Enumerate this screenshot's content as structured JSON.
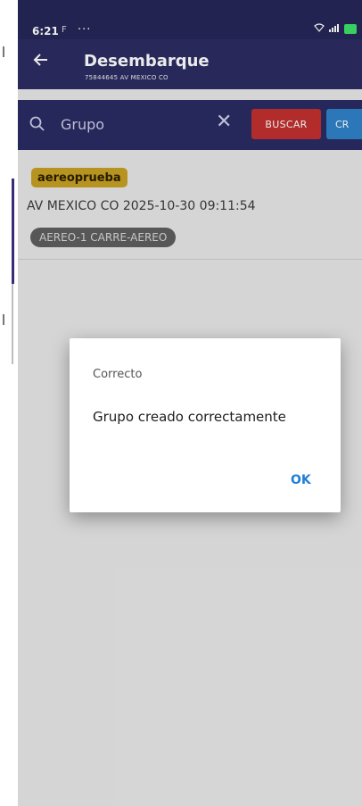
{
  "status_bar": {
    "time": "6:21",
    "notification": "F",
    "more": "···"
  },
  "app_bar": {
    "title": "Desembarque",
    "subtitle": "75844645 AV MEXICO CO",
    "back_icon": "arrow-left-icon"
  },
  "search": {
    "placeholder": "Grupo",
    "value": "",
    "search_button": "BUSCAR",
    "create_button": "CR"
  },
  "groups": [
    {
      "tag": "aereoprueba",
      "meta": "AV MEXICO CO  2025-10-30 09:11:54",
      "chip": "AEREO-1 CARRE-AEREO"
    }
  ],
  "dialog": {
    "title": "Correcto",
    "message": "Grupo creado correctamente",
    "ok": "OK"
  },
  "colors": {
    "primary": "#2c2d62",
    "danger": "#c0302f",
    "accent": "#2f82c8",
    "tag": "#c7a022",
    "link": "#1e7fd6"
  }
}
